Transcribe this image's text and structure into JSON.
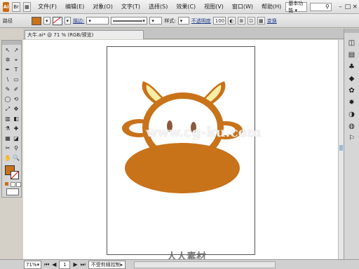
{
  "app": {
    "logo": "Ai"
  },
  "menu": {
    "items": [
      "文件(F)",
      "编辑(E)",
      "对象(O)",
      "文字(T)",
      "选择(S)",
      "效果(C)",
      "视图(V)",
      "窗口(W)",
      "帮助(H)"
    ],
    "workspace": "基本功能 ▾",
    "window_controls": [
      "–",
      "□",
      "×"
    ]
  },
  "control": {
    "selection_label": "路径",
    "fill_color": "#c8721a",
    "stroke_label": "描边:",
    "opacity_label": "不透明度",
    "opacity_value": "100",
    "style_label": "样式:",
    "transform_label": "变换"
  },
  "document": {
    "tab_title": "大牛.ai* @ 71 % (RGB/预览)"
  },
  "tools": {
    "glyphs": [
      "↖",
      "↗",
      "✲",
      "⌖",
      "✒",
      "T",
      "\\",
      "▭",
      "✎",
      "✐",
      "◯",
      "⟲",
      "⤢",
      "✥",
      "▥",
      "◧",
      "⚗",
      "✚",
      "▦",
      "◪",
      "✂",
      "⚲",
      "✋",
      "🔍"
    ]
  },
  "dock": {
    "icons": [
      "◫",
      "▤",
      "♣",
      "◆",
      "✿",
      "✹",
      "◑",
      "◍",
      "⚐"
    ]
  },
  "art": {
    "brown": "#c8721a",
    "cream": "#f7eea6",
    "white": "#ffffff",
    "eye_color": "#8a5a3c"
  },
  "status": {
    "zoom": "71%",
    "page": "1",
    "text": "不受剪辑控制"
  },
  "watermark": {
    "center": "www.cg-ku.com",
    "bottom": "人人素材"
  }
}
